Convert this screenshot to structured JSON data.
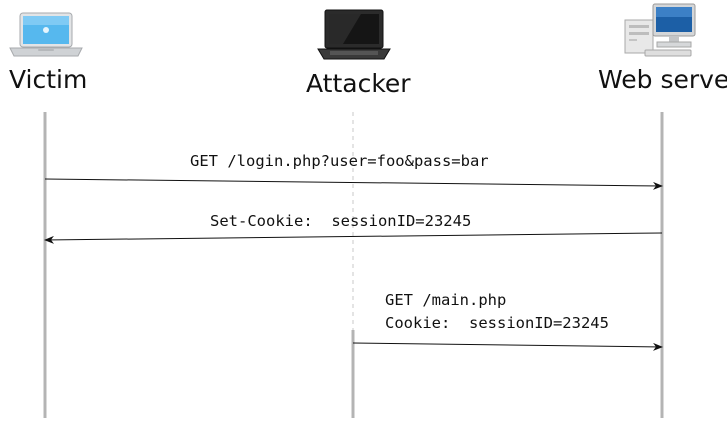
{
  "actors": {
    "victim": {
      "label": "Victim",
      "icon": "laptop-icon"
    },
    "attacker": {
      "label": "Attacker",
      "icon": "laptop-dark-icon"
    },
    "server": {
      "label": "Web server",
      "icon": "desktop-computer-icon"
    }
  },
  "messages": [
    {
      "from": "victim",
      "to": "server",
      "lines": [
        "GET /login.php?user=foo&pass=bar"
      ]
    },
    {
      "from": "server",
      "to": "victim",
      "lines": [
        "Set-Cookie:  sessionID=23245"
      ]
    },
    {
      "from": "attacker",
      "to": "server",
      "lines": [
        "GET /main.php",
        "Cookie:  sessionID=23245"
      ]
    }
  ]
}
